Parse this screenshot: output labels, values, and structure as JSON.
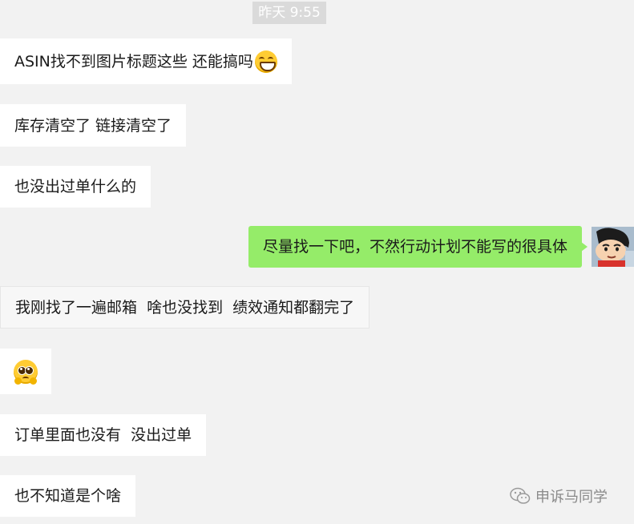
{
  "timestamp": "昨天 9:55",
  "messages": [
    {
      "text": "ASIN找不到图片标题这些 还能搞吗",
      "emoji": "grin-icon"
    },
    {
      "text": "库存清空了 链接清空了"
    },
    {
      "text": "也没出过单什么的"
    },
    {
      "text": "尽量找一下吧，不然行动计划不能写的很具体",
      "side": "right"
    },
    {
      "text": "我刚找了一遍邮箱  啥也没找到  绩效通知都翻完了"
    },
    {
      "emoji": "pleading-face-icon"
    },
    {
      "text": "订单里面也没有  没出过单"
    },
    {
      "text": "也不知道是个啥"
    }
  ],
  "watermark": "申诉马同学",
  "colors": {
    "background": "#f2f2f2",
    "incoming_bubble": "#ffffff",
    "outgoing_bubble": "#95ec69",
    "timestamp_bg": "#dadada"
  }
}
